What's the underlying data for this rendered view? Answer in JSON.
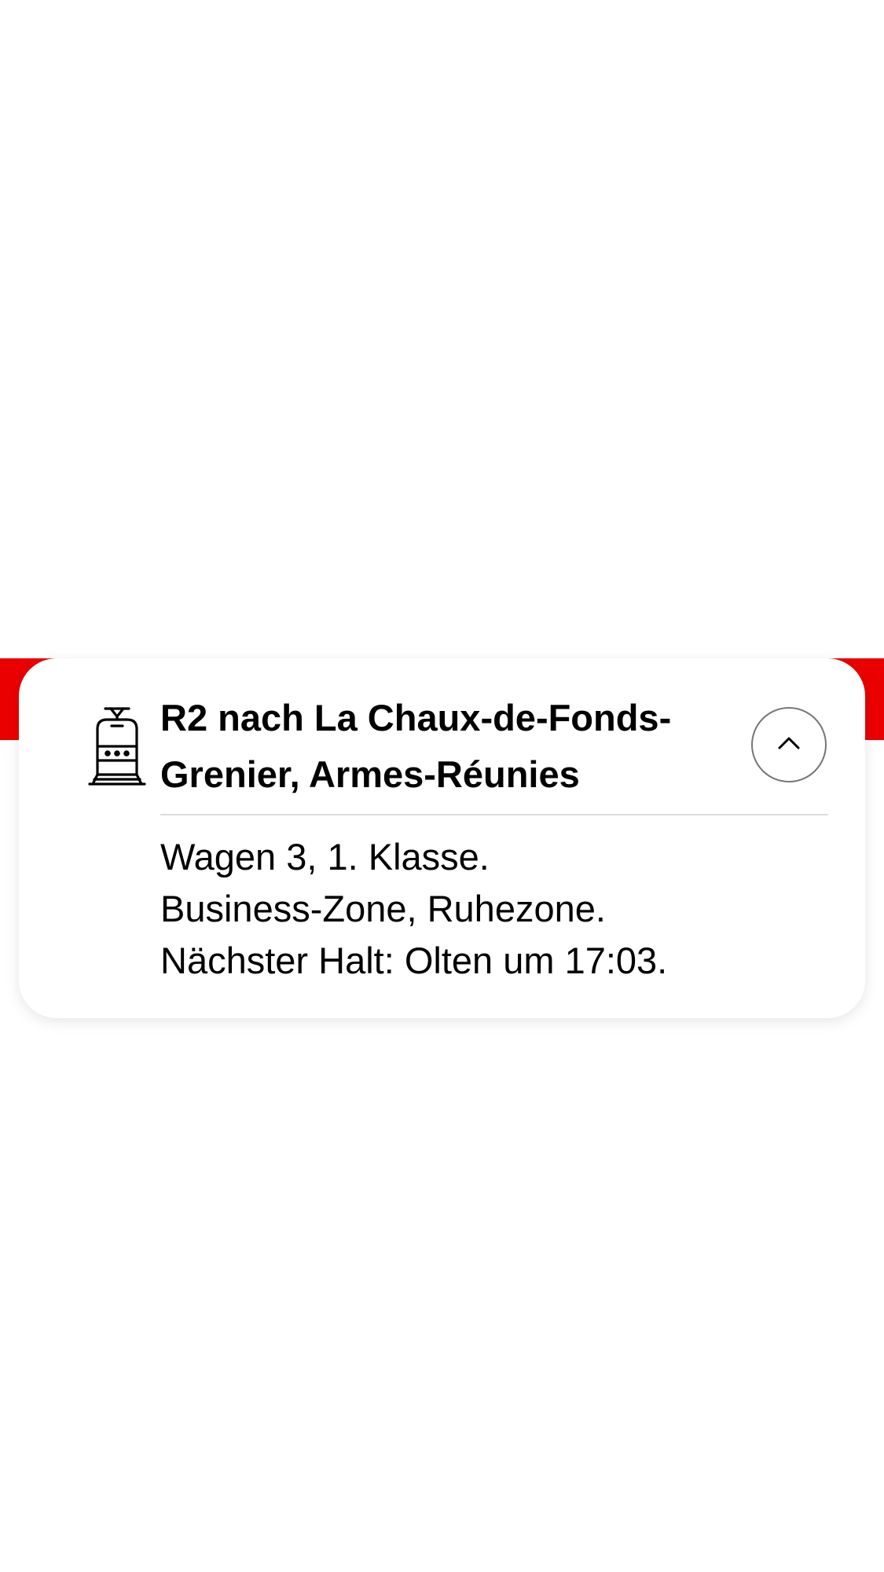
{
  "connection": {
    "title": "R2 nach La Chaux-de-Fonds-Grenier, Armes-Réunies",
    "transport_icon": "tram-icon",
    "collapse_icon": "chevron-up-icon",
    "details": [
      "Wagen 3, 1. Klasse.",
      "Business-Zone, Ruhezone.",
      "Nächster Halt: Olten um 17:03."
    ]
  },
  "colors": {
    "brand_red": "#eb0000",
    "card_background": "#ffffff",
    "text": "#000000",
    "button_border": "#767676",
    "divider": "#dcdcdc"
  }
}
